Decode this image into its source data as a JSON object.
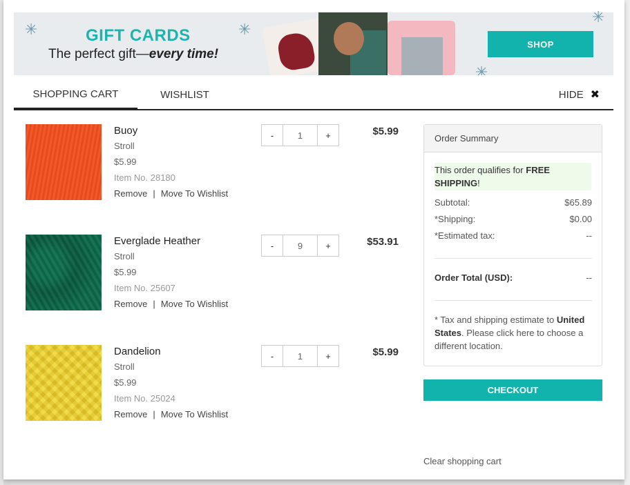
{
  "banner": {
    "title": "GIFT CARDS",
    "subtitle_plain": "The perfect gift—",
    "subtitle_em": "every time!",
    "shop_label": "SHOP"
  },
  "tabs": {
    "cart": "SHOPPING CART",
    "wishlist": "WISHLIST",
    "hide": "HIDE",
    "hide_icon": "✖"
  },
  "items": [
    {
      "name": "Buoy",
      "brand": "Stroll",
      "unit_price": "$5.99",
      "sku": "Item No. 28180",
      "qty": "1",
      "total": "$5.99",
      "color": "#e84a1d"
    },
    {
      "name": "Everglade Heather",
      "brand": "Stroll",
      "unit_price": "$5.99",
      "sku": "Item No. 25607",
      "qty": "9",
      "total": "$53.91",
      "color": "#0a5a3f"
    },
    {
      "name": "Dandelion",
      "brand": "Stroll",
      "unit_price": "$5.99",
      "sku": "Item No. 25024",
      "qty": "1",
      "total": "$5.99",
      "color": "#f1d83a"
    }
  ],
  "item_actions": {
    "remove": "Remove",
    "separator": "|",
    "move": "Move To Wishlist",
    "minus": "-",
    "plus": "+"
  },
  "summary": {
    "title": "Order Summary",
    "free_prefix": "This order qualifies for",
    "free_bold": "FREE SHIPPING",
    "free_suffix": "!",
    "subtotal_label": "Subtotal:",
    "subtotal_value": "$65.89",
    "shipping_label": "*Shipping:",
    "shipping_value": "$0.00",
    "tax_label": "*Estimated tax:",
    "tax_value": "--",
    "total_label": "Order Total (USD):",
    "total_value": "--",
    "note_prefix": "* Tax and shipping estimate to",
    "note_country": "United States",
    "note_suffix": ". Please click here to choose a different location."
  },
  "checkout_label": "CHECKOUT",
  "clear_label": "Clear shopping cart",
  "colors": {
    "accent": "#12b3ad",
    "banner_title": "#1fb3ad"
  }
}
